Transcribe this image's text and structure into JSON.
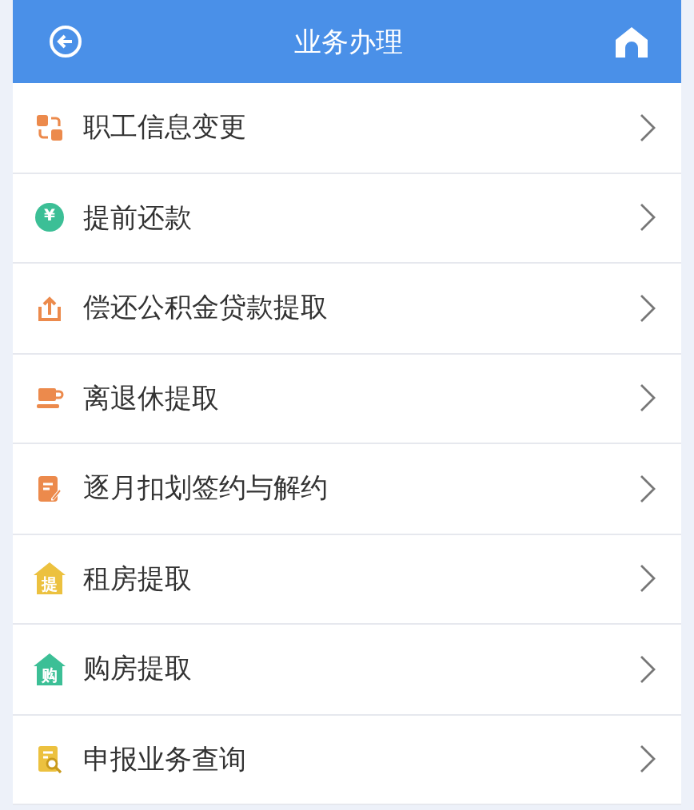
{
  "header": {
    "title": "业务办理"
  },
  "items": [
    {
      "label": "职工信息变更",
      "kind": "exchange"
    },
    {
      "label": "提前还款",
      "kind": "coin",
      "icon_text": "¥"
    },
    {
      "label": "偿还公积金贷款提取",
      "kind": "upload"
    },
    {
      "label": "离退休提取",
      "kind": "cup"
    },
    {
      "label": "逐月扣划签约与解约",
      "kind": "edit"
    },
    {
      "label": "租房提取",
      "kind": "house-yellow",
      "icon_text": "提"
    },
    {
      "label": "购房提取",
      "kind": "house-green",
      "icon_text": "购"
    },
    {
      "label": "申报业务查询",
      "kind": "search-doc"
    }
  ]
}
